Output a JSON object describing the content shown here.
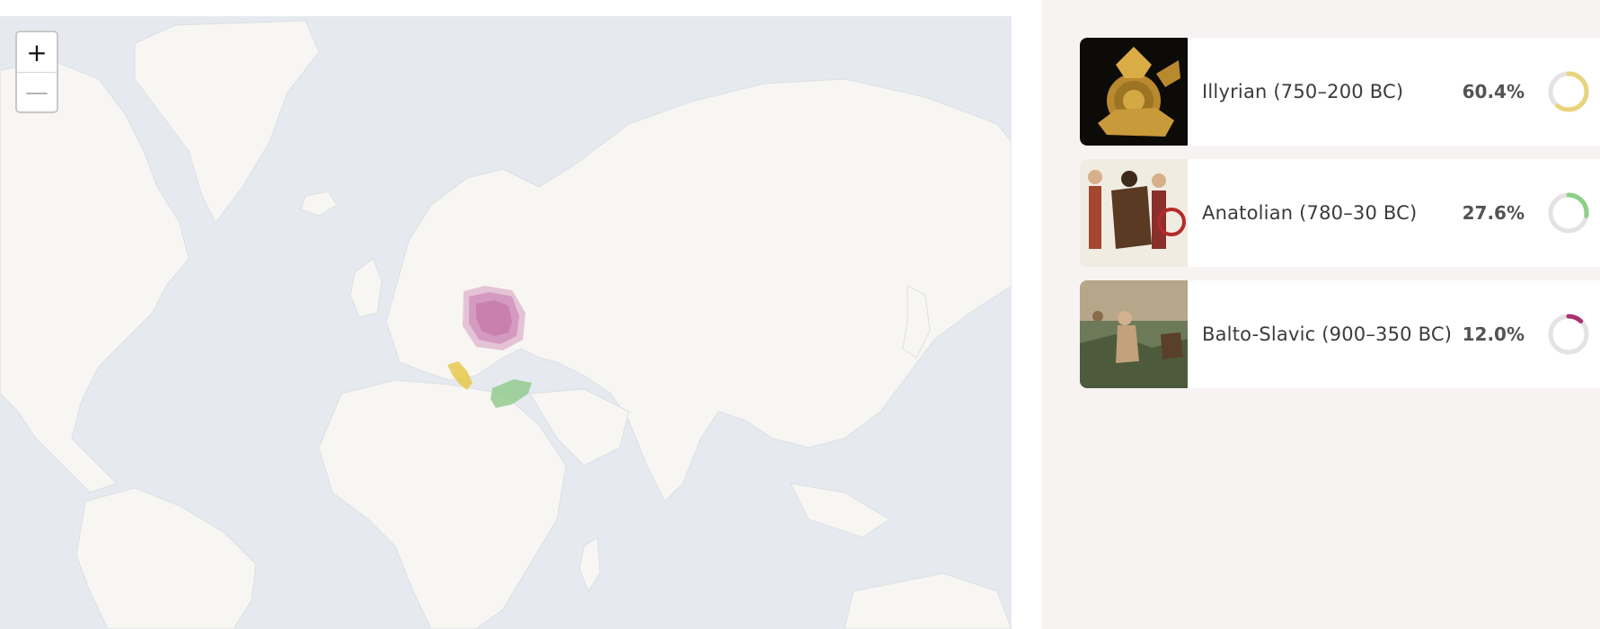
{
  "map": {
    "zoom_in_label": "+",
    "zoom_out_label": "—",
    "colors": {
      "ocean": "#e6eaf0",
      "land": "#f7f6f3",
      "illyrian_region": "#e8c84a",
      "anatolian_region": "#8fc98a",
      "balto_slavic_region": "#cf86b4"
    }
  },
  "results": [
    {
      "label": "Illyrian (750–200 BC)",
      "percent_text": "60.4%",
      "percent": 60.4,
      "color": "#e8d47a",
      "image_icon": "illyrian-artifact-image"
    },
    {
      "label": "Anatolian (780–30 BC)",
      "percent_text": "27.6%",
      "percent": 27.6,
      "color": "#8ccf86",
      "image_icon": "anatolian-warriors-image"
    },
    {
      "label": "Balto-Slavic (900–350 BC)",
      "percent_text": "12.0%",
      "percent": 12.0,
      "color": "#a8326e",
      "image_icon": "balto-slavic-scene-image"
    }
  ]
}
